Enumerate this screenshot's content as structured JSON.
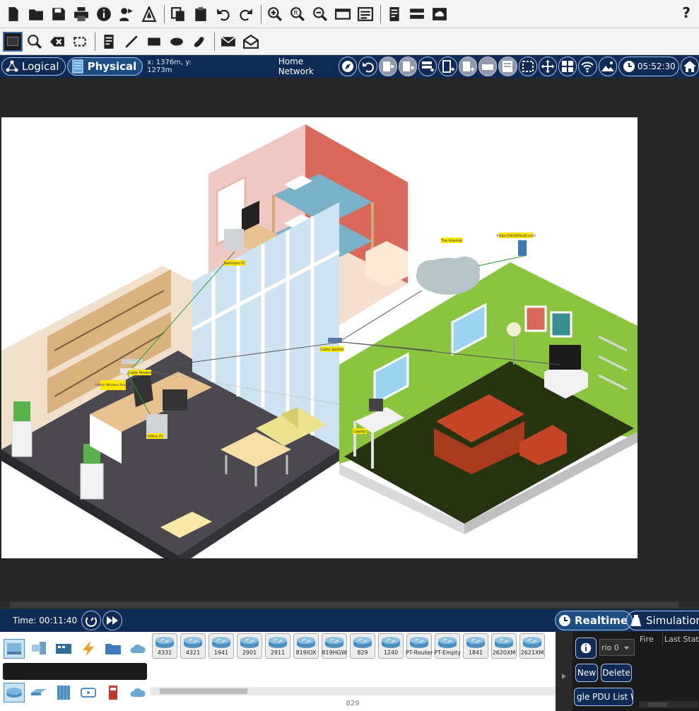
{
  "main_toolbar": {
    "buttons": [
      "new-file",
      "open-folder",
      "save",
      "print",
      "info",
      "activity-wizard",
      "custom-device",
      "copy",
      "paste",
      "undo",
      "redo",
      "zoom-in",
      "zoom-reset",
      "zoom-out",
      "rectangle-view",
      "palette",
      "text-note",
      "rack-view",
      "cloud-view"
    ],
    "help_label": "?"
  },
  "draw_toolbar": {
    "buttons": [
      "select",
      "inspect",
      "delete",
      "resize",
      "note",
      "line",
      "rectangle",
      "ellipse",
      "freeform",
      "add-simple-pdu",
      "add-complex-pdu"
    ]
  },
  "workspace_bar": {
    "logical_label": "Logical",
    "physical_label": "Physical",
    "coordinates": "x: 1376m, y: 1273m",
    "location_name": "Home Network",
    "clock": "05:52:30"
  },
  "canvas": {
    "labels": {
      "bedroom_pc": "Bedroom PC",
      "internet": "The Internet",
      "server": "https://skillsforall.com",
      "cable_modem": "Cable Modem",
      "router": "Home Wireless Router",
      "cable_splitter": "Cable Splitter",
      "office_pc": "Office PC",
      "laptop": "Laptop"
    }
  },
  "time_bar": {
    "time": "Time: 00:11:40",
    "realtime_label": "Realtime",
    "simulation_label": "Simulation"
  },
  "device_models": [
    "4331",
    "4321",
    "1941",
    "2901",
    "2911",
    "819IOX",
    "819HGW",
    "829",
    "1240",
    "PT-Router",
    "PT-Empty",
    "1841",
    "2620XM",
    "2621XM"
  ],
  "device_panel_label": "829",
  "pdu_panel": {
    "scenario": "rio 0",
    "new_label": "New",
    "delete_label": "Delete",
    "pdu_list_label": "gle PDU List Win",
    "col_fire": "Fire",
    "col_last_status": "Last Statu"
  },
  "colors": {
    "dark_navy": "#0e2a55",
    "workspace": "#262626",
    "label_yellow": "#ffe600",
    "wall_green": "#8bc43f",
    "sofa_red": "#c64526"
  }
}
